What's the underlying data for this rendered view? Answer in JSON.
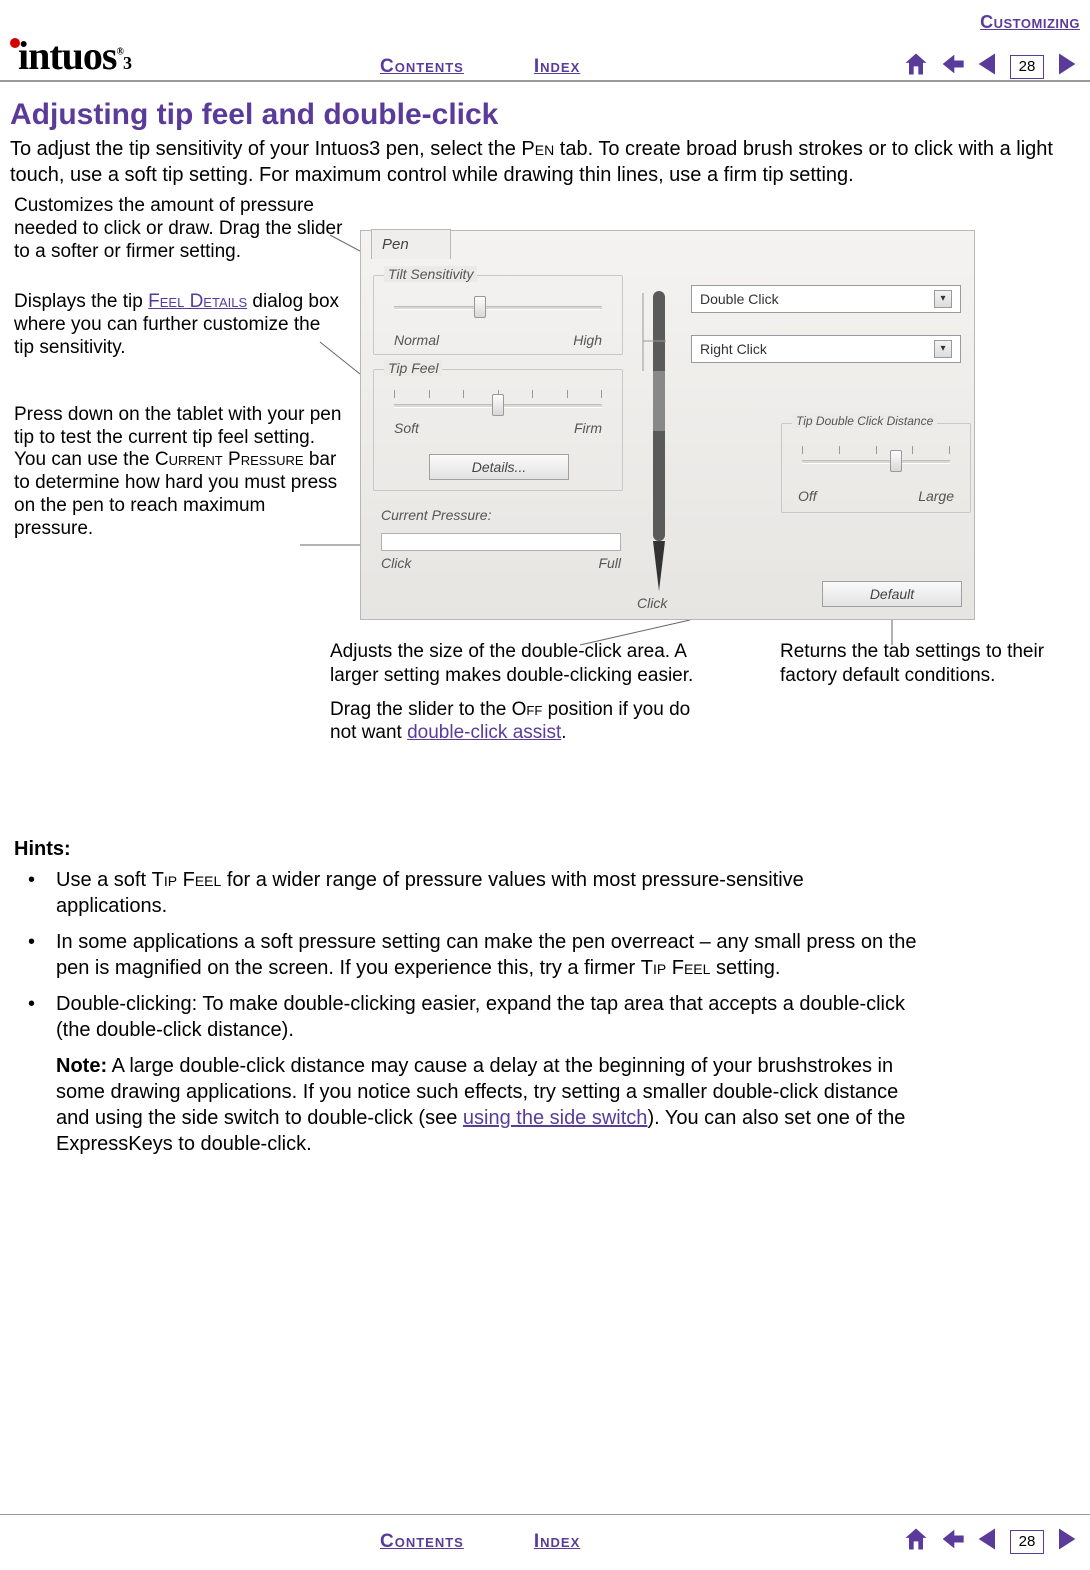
{
  "header": {
    "section": "Customizing",
    "logo_text": "intuos",
    "logo_sub": "3",
    "contents": "Contents",
    "index": "Index",
    "page": "28"
  },
  "title": "Adjusting tip feel and double-click",
  "intro_a": "To adjust the tip sensitivity of your Intuos3 pen, select the ",
  "intro_pen": "Pen",
  "intro_b": " tab.  To create broad brush strokes or to click with a light touch, use a soft tip setting.  For maximum control while drawing thin lines, use a firm tip setting.",
  "callouts": {
    "c1": "Customizes the amount of pressure needed to click or draw.  Drag the slider to a softer or firmer setting.",
    "c2a": "Displays the tip ",
    "c2link": "Feel Details",
    "c2b": " dialog box where you can further customize the tip sensitivity.",
    "c3a": "Press down on the tablet with your pen tip to test the current tip feel setting.  You can use the ",
    "c3sc": "Current Pressure",
    "c3b": " bar to determine how hard you must press on the pen to reach maximum pressure."
  },
  "panel": {
    "tab": "Pen",
    "tilt": {
      "title": "Tilt Sensitivity",
      "low": "Normal",
      "high": "High"
    },
    "tipfeel": {
      "title": "Tip Feel",
      "low": "Soft",
      "high": "Firm",
      "details": "Details..."
    },
    "pressure": {
      "label": "Current Pressure:",
      "low": "Click",
      "high": "Full"
    },
    "click_label": "Click",
    "dd1": "Double Click",
    "dd2": "Right Click",
    "dist": {
      "title": "Tip Double Click Distance",
      "low": "Off",
      "high": "Large"
    },
    "default": "Default"
  },
  "below": {
    "col1a": "Adjusts the size of the double-click area.  A larger setting makes double-clicking easier.",
    "col1b_a": "Drag the slider to the ",
    "col1b_sc": "Off",
    "col1b_b": " position if you do not want ",
    "col1b_link": "double-click assist",
    "col1b_c": ".",
    "col2": "Returns the tab settings to their factory default conditions."
  },
  "hints": {
    "title": "Hints:",
    "h1a": "Use a soft ",
    "h1sc": "Tip Feel",
    "h1b": " for a wider range of pressure values with most pressure-sensitive applications.",
    "h2a": "In some applications a soft pressure setting can make the pen overreact – any small press on the pen is magnified on the screen.  If you experience this, try a firmer ",
    "h2sc": "Tip Feel",
    "h2b": " setting.",
    "h3": "Double-clicking: To make double-clicking easier, expand the tap area that accepts a double-click (the double-click distance).",
    "note_a": "Note:",
    "note_b": " A large double-click distance may cause a delay at the beginning of your brushstrokes in some drawing applications.  If you notice such effects, try setting a smaller double-click distance and using the side switch to double-click (see ",
    "note_link": "using the side switch",
    "note_c": ").  You can also set one of the ExpressKeys to double-click."
  }
}
